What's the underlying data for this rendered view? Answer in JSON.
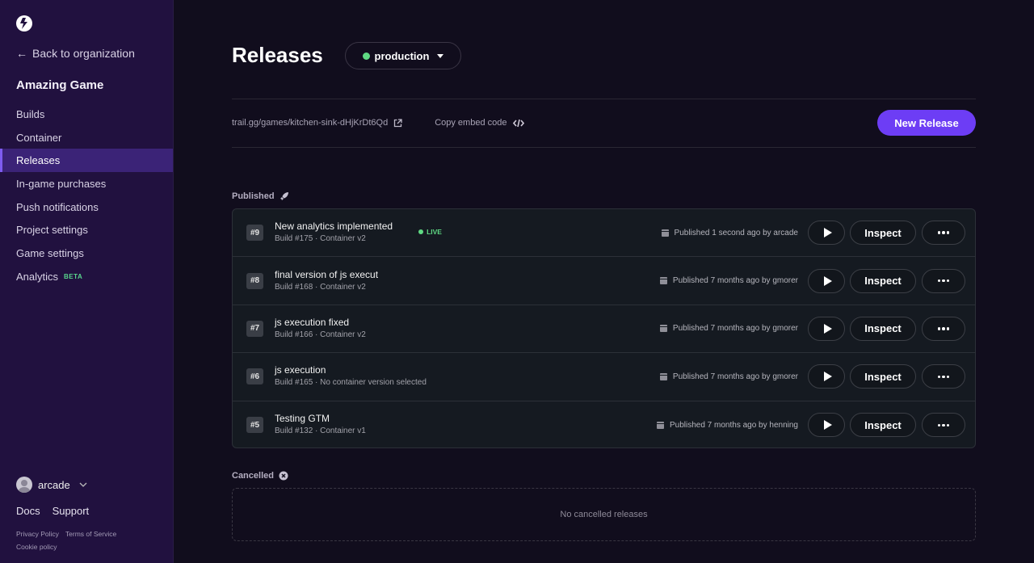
{
  "sidebar": {
    "back_label": "Back to organization",
    "project_title": "Amazing Game",
    "nav": [
      {
        "label": "Builds"
      },
      {
        "label": "Container"
      },
      {
        "label": "Releases",
        "active": true
      },
      {
        "label": "In-game purchases"
      },
      {
        "label": "Push notifications"
      },
      {
        "label": "Project settings"
      },
      {
        "label": "Game settings"
      },
      {
        "label": "Analytics",
        "badge": "BETA"
      }
    ],
    "user": "arcade",
    "links": [
      "Docs",
      "Support"
    ],
    "legal": [
      "Privacy Policy",
      "Terms of Service",
      "Cookie policy"
    ]
  },
  "header": {
    "title": "Releases",
    "environment": "production"
  },
  "share": {
    "url": "trail.gg/games/kitchen-sink-dHjKrDt6Qd",
    "embed_label": "Copy embed code",
    "new_release_label": "New Release"
  },
  "published": {
    "label": "Published",
    "releases": [
      {
        "num": "#9",
        "name": "New analytics implemented",
        "sub": "Build #175 · Container v2",
        "live": "LIVE",
        "published": "Published 1 second ago by arcade"
      },
      {
        "num": "#8",
        "name": "final version of js execut",
        "sub": "Build #168 · Container v2",
        "published": "Published 7 months ago by gmorer"
      },
      {
        "num": "#7",
        "name": "js execution fixed",
        "sub": "Build #166 · Container v2",
        "published": "Published 7 months ago by gmorer"
      },
      {
        "num": "#6",
        "name": "js execution",
        "sub": "Build #165 · No container version selected",
        "published": "Published 7 months ago by gmorer"
      },
      {
        "num": "#5",
        "name": "Testing GTM",
        "sub": "Build #132 · Container v1",
        "published": "Published 7 months ago by henning"
      }
    ],
    "inspect_label": "Inspect"
  },
  "cancelled": {
    "label": "Cancelled",
    "empty_text": "No cancelled releases"
  },
  "colors": {
    "accent": "#6d3df5",
    "live": "#5fd983",
    "sidebar_bg": "#21113f",
    "active_nav": "#3b2377"
  }
}
